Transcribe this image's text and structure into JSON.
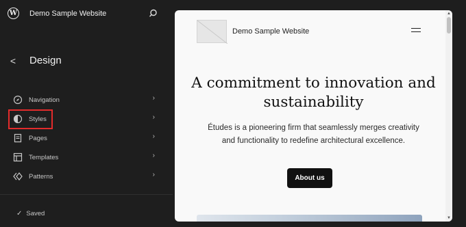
{
  "topbar": {
    "logo_text": "W",
    "site_title": "Demo Sample Website"
  },
  "design": {
    "back_label": "<",
    "title": "Design"
  },
  "nav": {
    "items": [
      {
        "label": "Navigation",
        "icon": "compass-icon"
      },
      {
        "label": "Styles",
        "icon": "half-circle-icon"
      },
      {
        "label": "Pages",
        "icon": "page-icon"
      },
      {
        "label": "Templates",
        "icon": "layout-icon"
      },
      {
        "label": "Patterns",
        "icon": "diamond-icon"
      }
    ],
    "chevron": "›"
  },
  "status": {
    "check": "✓",
    "saved_label": "Saved"
  },
  "preview": {
    "site_name": "Demo Sample Website",
    "heading": "A commitment to innovation and sustainability",
    "body": "Études is a pioneering firm that seamlessly merges creativity and functionality to redefine architectural excellence.",
    "button_label": "About us"
  },
  "colors": {
    "sidebar_bg": "#1e1e1e",
    "highlight": "#e32b2b",
    "preview_bg": "#f9f9f9",
    "button_bg": "#111111"
  }
}
